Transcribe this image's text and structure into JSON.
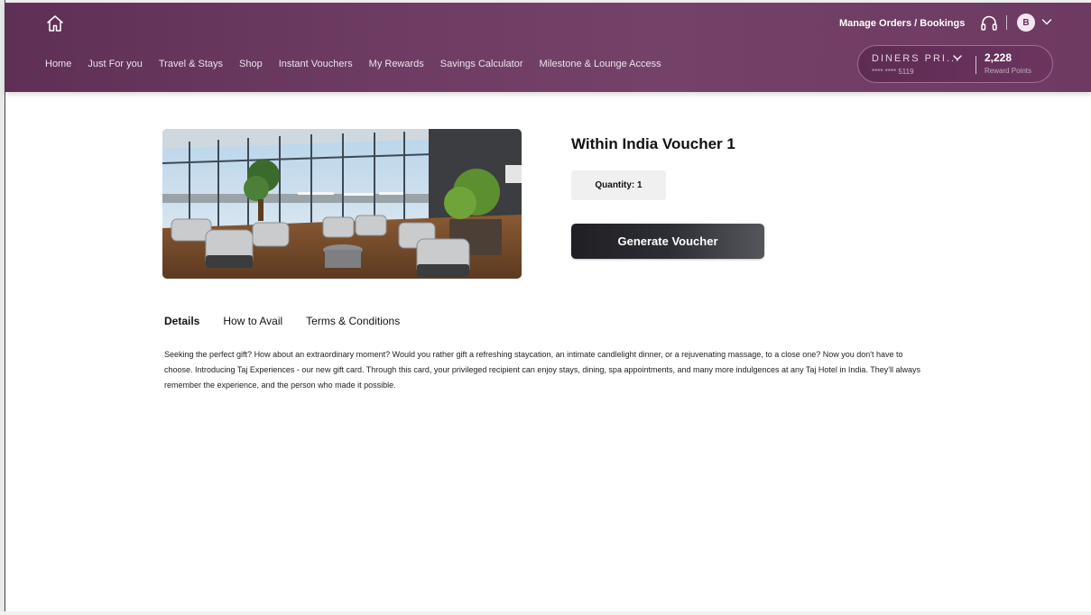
{
  "header": {
    "nav": [
      "Home",
      "Just For you",
      "Travel & Stays",
      "Shop",
      "Instant Vouchers",
      "My Rewards",
      "Savings Calculator",
      "Milestone & Lounge Access"
    ],
    "manage_orders": "Manage Orders / Bookings",
    "avatar_initial": "B",
    "card": {
      "name": "DINERS PRI...",
      "number": "**** **** 5119",
      "points": "2,228",
      "points_label": "Reward Points"
    }
  },
  "product": {
    "title": "Within India Voucher 1",
    "quantity": "Quantity: 1",
    "generate_label": "Generate Voucher"
  },
  "tabs": [
    "Details",
    "How to Avail",
    "Terms & Conditions"
  ],
  "description": "Seeking the perfect gift? How about an extraordinary moment? Would you rather gift a refreshing staycation, an intimate candlelight dinner, or a rejuvenating massage, to a close one? Now you don't have to choose. Introducing Taj Experiences - our new gift card. Through this card, your privileged recipient can enjoy stays, dining, spa appointments, and many more indulgences at any Taj Hotel in India. They'll always remember the experience, and the person who made it possible.",
  "icons": {
    "home": "home-icon",
    "support": "headset-icon",
    "chevron": "chevron-down-icon"
  },
  "colors": {
    "header": "#6e3c63",
    "button": "#2d2e33"
  }
}
